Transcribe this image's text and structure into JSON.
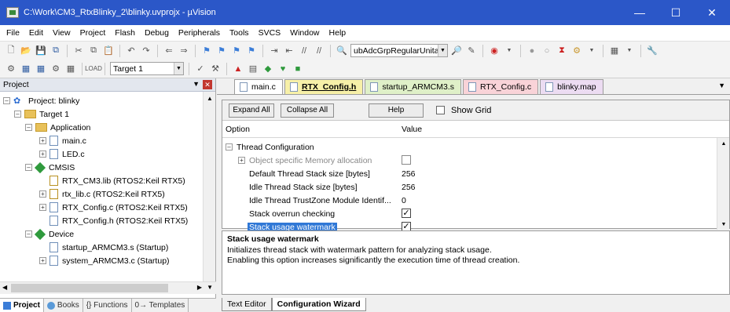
{
  "window": {
    "title": "C:\\Work\\CM3_RtxBlinky_2\\blinky.uvprojx - µVision"
  },
  "menu": [
    "File",
    "Edit",
    "View",
    "Project",
    "Flash",
    "Debug",
    "Peripherals",
    "Tools",
    "SVCS",
    "Window",
    "Help"
  ],
  "toolbar": {
    "find_combo": "ubAdcGrpRegularUnitar",
    "target_combo": "Target 1"
  },
  "project_panel": {
    "title": "Project",
    "tree": [
      {
        "label": "Project: blinky",
        "level": 0,
        "type": "project",
        "expanded": true
      },
      {
        "label": "Target 1",
        "level": 1,
        "type": "target",
        "expanded": true
      },
      {
        "label": "Application",
        "level": 2,
        "type": "folder",
        "expanded": true
      },
      {
        "label": "main.c",
        "level": 3,
        "type": "file",
        "expander": "+"
      },
      {
        "label": "LED.c",
        "level": 3,
        "type": "file",
        "expander": "+"
      },
      {
        "label": "CMSIS",
        "level": 2,
        "type": "component",
        "expanded": true
      },
      {
        "label": "RTX_CM3.lib (RTOS2:Keil RTX5)",
        "level": 3,
        "type": "lib",
        "expander": ""
      },
      {
        "label": "rtx_lib.c (RTOS2:Keil RTX5)",
        "level": 3,
        "type": "lib",
        "expander": "+"
      },
      {
        "label": "RTX_Config.c (RTOS2:Keil RTX5)",
        "level": 3,
        "type": "file",
        "expander": "+"
      },
      {
        "label": "RTX_Config.h (RTOS2:Keil RTX5)",
        "level": 3,
        "type": "file",
        "expander": ""
      },
      {
        "label": "Device",
        "level": 2,
        "type": "component",
        "expanded": true
      },
      {
        "label": "startup_ARMCM3.s (Startup)",
        "level": 3,
        "type": "file",
        "expander": ""
      },
      {
        "label": "system_ARMCM3.c (Startup)",
        "level": 3,
        "type": "file",
        "expander": "+"
      }
    ],
    "bottom_tabs": [
      "Project",
      "Books",
      "{} Functions",
      "0→ Templates"
    ]
  },
  "editor": {
    "tabs": [
      {
        "label": "main.c",
        "color": "#ffffff"
      },
      {
        "label": "RTX_Config.h",
        "color": "#f7f0a8",
        "active": true
      },
      {
        "label": "startup_ARMCM3.s",
        "color": "#dff0c8"
      },
      {
        "label": "RTX_Config.c",
        "color": "#f9d3d8"
      },
      {
        "label": "blinky.map",
        "color": "#ecdcf2"
      }
    ],
    "wizard": {
      "expand_all": "Expand All",
      "collapse_all": "Collapse All",
      "help": "Help",
      "show_grid": "Show Grid",
      "col_option": "Option",
      "col_value": "Value",
      "rows": [
        {
          "option": "Thread Configuration",
          "value": "",
          "kind": "section"
        },
        {
          "option": "Object specific Memory allocation",
          "value": "",
          "kind": "checkbox",
          "checked": false,
          "disabled": true
        },
        {
          "option": "Default Thread Stack size [bytes]",
          "value": "256",
          "kind": "text"
        },
        {
          "option": "Idle Thread Stack size [bytes]",
          "value": "256",
          "kind": "text"
        },
        {
          "option": "Idle Thread TrustZone Module Identif...",
          "value": "0",
          "kind": "text"
        },
        {
          "option": "Stack overrun checking",
          "value": "",
          "kind": "checkbox",
          "checked": true
        },
        {
          "option": "Stack usage watermark",
          "value": "",
          "kind": "checkbox",
          "checked": true,
          "selected": true
        }
      ]
    },
    "description": {
      "title": "Stack usage watermark",
      "line1": "Initializes thread stack with watermark pattern for analyzing stack usage.",
      "line2": "Enabling this option increases significantly the execution time of thread creation."
    },
    "bottom_tabs": [
      "Text Editor",
      "Configuration Wizard"
    ]
  }
}
